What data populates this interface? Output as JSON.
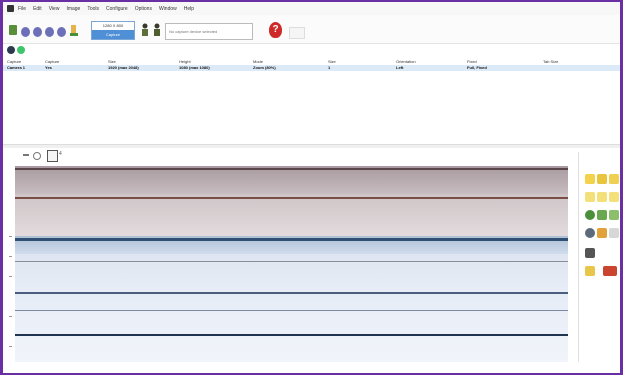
{
  "menubar": {
    "items": [
      "File",
      "Edit",
      "View",
      "Image",
      "Tools",
      "Configure",
      "Options",
      "Window",
      "Help"
    ]
  },
  "toolbar": {
    "size_box_top": "1280 X 800",
    "size_box_bottom": "Capture",
    "url_placeholder": "No capture device selected",
    "help_label": "?",
    "colors": {
      "rec_dot": "#6d6fb8",
      "help": "#cf2a2a",
      "accent": "#4f8fd6"
    }
  },
  "status": {
    "icons": [
      "dark-circle-icon",
      "green-circle-icon"
    ]
  },
  "device_table": {
    "headers": [
      "Capture",
      "Capture",
      "Size",
      "Height",
      "Mode",
      "Size",
      "Orientation",
      "Fixed",
      "Tab Size"
    ],
    "rows": [
      [
        "Camera 1",
        "Yes",
        "1920 (max 2048)",
        "1080 (max 1080)",
        "Zoom (80%)",
        "1",
        "Left",
        "Full, Fixed",
        ""
      ]
    ]
  },
  "capture_controls": {
    "zoom_label": "4",
    "items": [
      "zoom-out-icon",
      "zoom-in-icon",
      "crop-icon"
    ]
  },
  "capture": {
    "bands": [
      {
        "color": "#b8aeb2"
      },
      {
        "color": "#d9d0d2"
      },
      {
        "color": "#c6cfd9"
      },
      {
        "color": "#d8e3ef"
      },
      {
        "color": "#e6ecf6"
      },
      {
        "color": "#edf1f8"
      }
    ]
  },
  "right_tools": {
    "items": [
      "pencil-icon",
      "text-icon",
      "arrow-icon",
      "check-icon",
      "cross-icon",
      "square-icon",
      "settings-icon",
      "brush-icon",
      "line-icon",
      "marker-icon",
      "eraser-icon",
      "calendar-icon"
    ]
  }
}
